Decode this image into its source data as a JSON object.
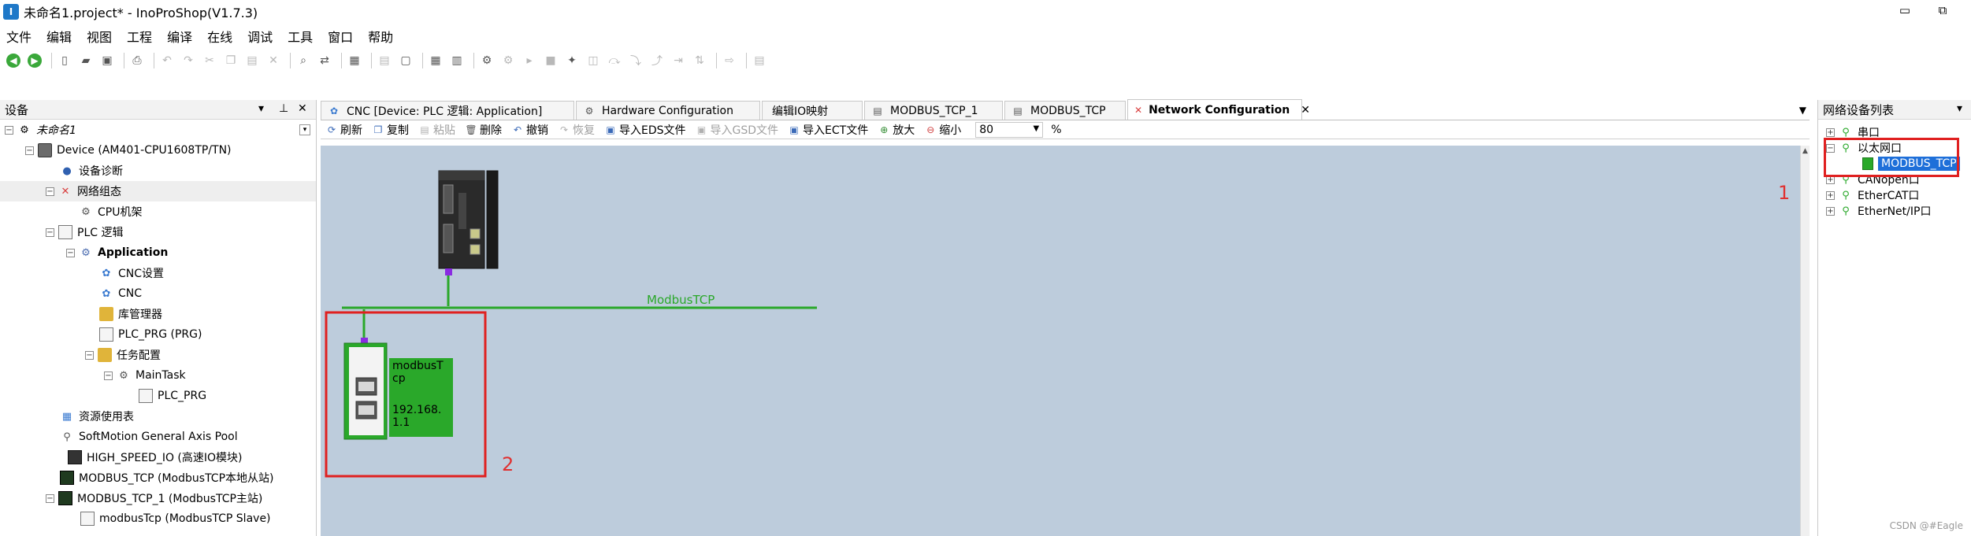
{
  "window": {
    "title": "未命名1.project* - InoProShop(V1.7.3)",
    "app_icon": "inoproshop-app-icon",
    "controls": [
      "restore-icon",
      "maximize-icon"
    ]
  },
  "menu": [
    "文件",
    "编辑",
    "视图",
    "工程",
    "编译",
    "在线",
    "调试",
    "工具",
    "窗口",
    "帮助"
  ],
  "devices_panel": {
    "title": "设备",
    "tree": [
      {
        "label": "未命名1",
        "style": "italic",
        "icon": "project-icon"
      },
      {
        "label": "Device (AM401-CPU1608TP/TN)",
        "icon": "device-icon"
      },
      {
        "label": "设备诊断",
        "icon": "diagnostics-icon"
      },
      {
        "label": "网络组态",
        "icon": "network-config-icon"
      },
      {
        "label": "CPU机架",
        "icon": "cpu-rack-icon"
      },
      {
        "label": "PLC 逻辑",
        "icon": "plc-logic-icon"
      },
      {
        "label": "Application",
        "style": "bold",
        "icon": "application-gear-icon"
      },
      {
        "label": "CNC设置",
        "icon": "cnc-icon"
      },
      {
        "label": "CNC",
        "icon": "cnc-icon"
      },
      {
        "label": "库管理器",
        "icon": "library-icon"
      },
      {
        "label": "PLC_PRG (PRG)",
        "icon": "program-icon"
      },
      {
        "label": "任务配置",
        "icon": "task-config-icon"
      },
      {
        "label": "MainTask",
        "icon": "task-icon"
      },
      {
        "label": "PLC_PRG",
        "icon": "program-icon"
      },
      {
        "label": "资源使用表",
        "icon": "resource-table-icon"
      },
      {
        "label": "SoftMotion General Axis Pool",
        "icon": "axis-pool-icon"
      },
      {
        "label": "HIGH_SPEED_IO (高速IO模块)",
        "icon": "io-module-icon"
      },
      {
        "label": "MODBUS_TCP (ModbusTCP本地从站)",
        "icon": "modbus-module-icon"
      },
      {
        "label": "MODBUS_TCP_1 (ModbusTCP主站)",
        "icon": "modbus-module-icon"
      },
      {
        "label": "modbusTcp (ModbusTCP Slave)",
        "icon": "modbus-slave-icon"
      }
    ]
  },
  "tabs": [
    {
      "label": "CNC [Device: PLC 逻辑: Application]",
      "icon": "cnc-tab-icon"
    },
    {
      "label": "Hardware Configuration",
      "icon": "hardware-tab-icon"
    },
    {
      "label": "编辑IO映射",
      "icon": "io-map-tab-icon"
    },
    {
      "label": "MODBUS_TCP_1",
      "icon": "modbus-tab-icon"
    },
    {
      "label": "MODBUS_TCP",
      "icon": "modbus-tab-icon"
    },
    {
      "label": "Network Configuration",
      "icon": "network-tab-icon",
      "active": true
    }
  ],
  "net_toolbar": {
    "refresh": "刷新",
    "copy": "复制",
    "paste": "粘贴",
    "delete": "删除",
    "undo": "撤销",
    "redo": "恢复",
    "import_eds": "导入EDS文件",
    "import_gsd": "导入GSD文件",
    "import_ect": "导入ECT文件",
    "zoom_in": "放大",
    "zoom_out": "缩小",
    "zoom_value": "80",
    "zoom_unit": "%"
  },
  "canvas": {
    "bus_label": "ModbusTCP",
    "slave_name": "modbusTcp",
    "slave_ip": "192.168.1.1",
    "background": "#bdccdc",
    "bus_color": "#2aa82a"
  },
  "network_devices_panel": {
    "title": "网络设备列表",
    "tree": [
      {
        "label": "串口"
      },
      {
        "label": "以太网口"
      },
      {
        "label": "MODBUS_TCP",
        "selected": true
      },
      {
        "label": "CANopen口"
      },
      {
        "label": "EtherCAT口"
      },
      {
        "label": "EtherNet/IP口"
      }
    ]
  },
  "annotations": {
    "label_1": "1",
    "label_2": "2",
    "color": "#e02020"
  },
  "watermark": "CSDN @#Eagle"
}
